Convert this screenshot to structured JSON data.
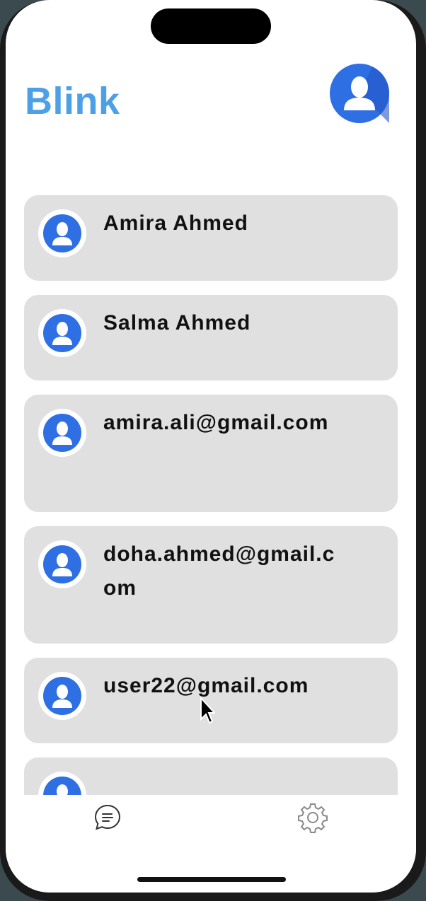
{
  "app": {
    "title": "Blink"
  },
  "colors": {
    "brand": "#4ea0e6",
    "avatar_blue": "#2f6fe4",
    "card_bg": "#e0e0e0"
  },
  "contacts": [
    {
      "label": "Amira Ahmed"
    },
    {
      "label": "Salma Ahmed"
    },
    {
      "label": "amira.ali@gmail.com"
    },
    {
      "label": "doha.ahmed@gmail.com"
    },
    {
      "label": "user22@gmail.com"
    },
    {
      "label": ""
    }
  ],
  "tabbar": {
    "items": [
      {
        "icon": "chat-icon"
      },
      {
        "icon": "gear-icon"
      }
    ]
  }
}
